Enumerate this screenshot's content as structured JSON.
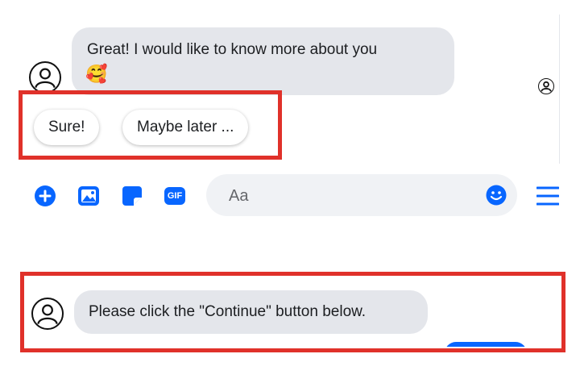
{
  "messages": [
    {
      "sender_avatar": "avatar-outline-icon",
      "text": "Great! I would like to know more about you",
      "emoji": "🥰"
    },
    {
      "sender_avatar": "avatar-outline-icon",
      "text": "Please click the \"Continue\" button below."
    }
  ],
  "quick_replies": [
    {
      "label": "Sure!"
    },
    {
      "label": "Maybe later ..."
    }
  ],
  "composer": {
    "placeholder": "Aa",
    "tools": [
      "add-icon",
      "photo-icon",
      "sticker-icon",
      "gif-icon"
    ],
    "gif_label": "GIF",
    "emoji_icon": "smiley-icon",
    "menu_icon": "menu-icon"
  },
  "colors": {
    "accent": "#0866ff",
    "highlight": "#e0312a",
    "bubble": "#e4e6eb",
    "composer_bg": "#f0f2f5"
  }
}
